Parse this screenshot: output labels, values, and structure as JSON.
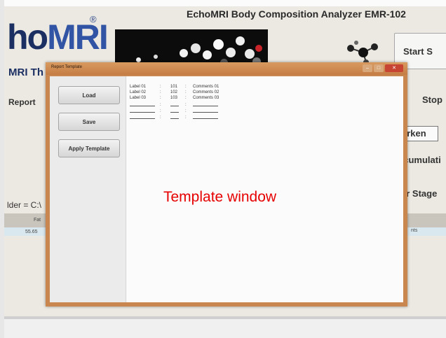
{
  "app": {
    "title": "EchoMRI Body Composition Analyzer  EMR-102",
    "logo": {
      "part1": "ho",
      "part2": "MRI",
      "registered": "®",
      "tagline": "MRI Th"
    },
    "buttons": {
      "start": "Start S",
      "stop": "Stop"
    },
    "side_labels": {
      "markers": "arken",
      "accumulation": "ccumulati",
      "stage": "er Stage"
    },
    "left_labels": {
      "report": "Report",
      "folder": "lder = C:\\"
    },
    "table_fragments": {
      "col_fat": "Fat",
      "val": "55.65",
      "col_right": "nts"
    }
  },
  "dialog": {
    "title": "Report Template",
    "controls": {
      "minimize": "–",
      "maximize": "□",
      "close": "✕"
    },
    "buttons": {
      "load": "Load",
      "save": "Save",
      "apply": "Apply Template"
    },
    "rows": [
      {
        "label": "Label 01",
        "value": "101",
        "comment": "Comments 01"
      },
      {
        "label": "Label 02",
        "value": "102",
        "comment": "Comments 02"
      },
      {
        "label": "Label 03",
        "value": "103",
        "comment": "Comments 03"
      }
    ],
    "separator": ":"
  },
  "annotation": {
    "text": "Template window",
    "color": "#e60000"
  }
}
